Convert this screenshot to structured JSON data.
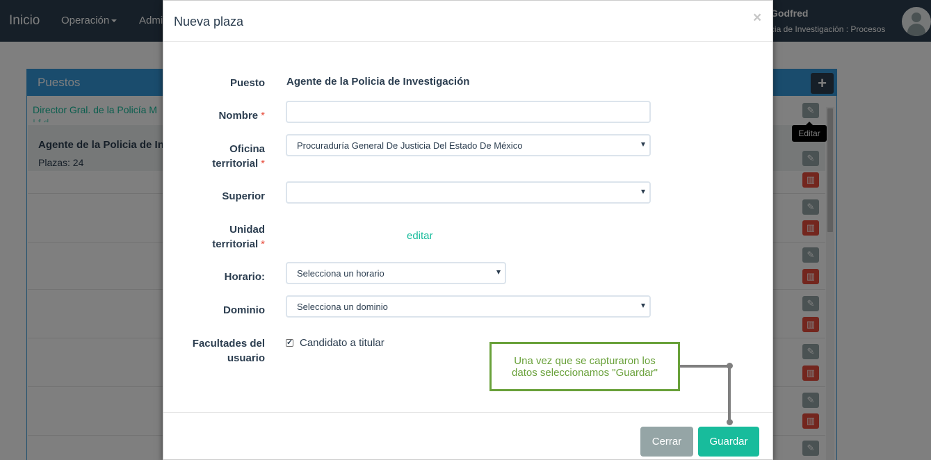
{
  "navbar": {
    "brand": "Inicio",
    "items": [
      {
        "label": "Operación"
      },
      {
        "label": "Admi"
      }
    ],
    "user_name": "Godfred",
    "user_role": "cia de Investigación : Procesos"
  },
  "panel": {
    "title": "Puestos",
    "add_icon": "plus-icon",
    "list_link": "Director Gral. de la Policía M",
    "list_link_cut": "I                           f   d",
    "active_item": {
      "title": "Agente de la Policia de Inve",
      "subtitle": "Plazas: 24"
    },
    "tooltip": "Editar",
    "row_icons": [
      "edit-icon",
      "trash-icon"
    ]
  },
  "modal": {
    "title": "Nueva plaza",
    "close": "×",
    "fields": {
      "puesto_label": "Puesto",
      "puesto_value": "Agente de la Policia de Investigación",
      "nombre_label": "Nombre",
      "nombre_value": "",
      "oficina_label_1": "Oficina",
      "oficina_label_2": "territorial",
      "oficina_value": "Procuraduría General De Justicia Del Estado De México",
      "superior_label": "Superior",
      "superior_value": "",
      "unidad_label_1": "Unidad",
      "unidad_label_2": "territorial",
      "unidad_link": "editar",
      "horario_label": "Horario:",
      "horario_value": "Selecciona un horario",
      "dominio_label": "Dominio",
      "dominio_value": "Selecciona un dominio",
      "facultades_label_1": "Facultades del",
      "facultades_label_2": "usuario",
      "candidato_label": "Candidato a titular",
      "candidato_checked": true,
      "required_mark": "*"
    },
    "buttons": {
      "close": "Cerrar",
      "save": "Guardar"
    }
  },
  "annotation": {
    "line1": "Una vez que se capturaron los",
    "line2": "datos seleccionamos  \"Guardar\""
  },
  "colors": {
    "navbar": "#2c3e50",
    "panel_primary": "#3498db",
    "success": "#18bc9c",
    "danger": "#e74c3c",
    "muted": "#95a5a6",
    "annotation": "#69a13a"
  }
}
